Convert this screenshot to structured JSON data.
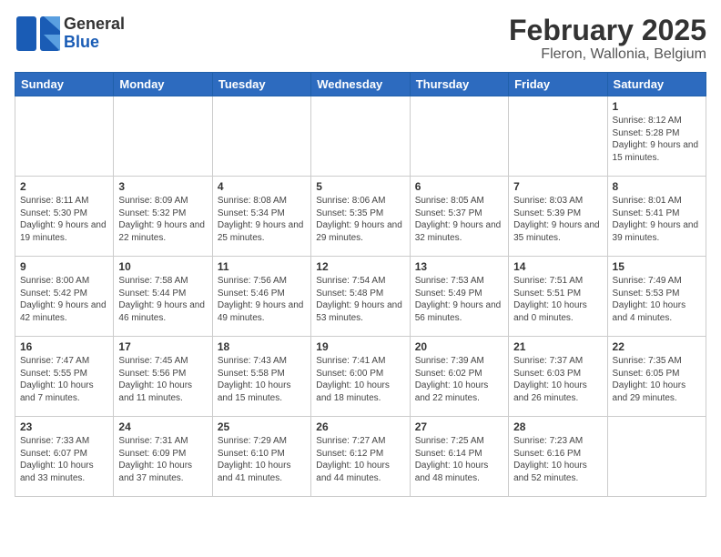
{
  "header": {
    "logo_general": "General",
    "logo_blue": "Blue",
    "title": "February 2025",
    "subtitle": "Fleron, Wallonia, Belgium"
  },
  "calendar": {
    "days_of_week": [
      "Sunday",
      "Monday",
      "Tuesday",
      "Wednesday",
      "Thursday",
      "Friday",
      "Saturday"
    ],
    "weeks": [
      {
        "days": [
          {
            "num": "",
            "detail": ""
          },
          {
            "num": "",
            "detail": ""
          },
          {
            "num": "",
            "detail": ""
          },
          {
            "num": "",
            "detail": ""
          },
          {
            "num": "",
            "detail": ""
          },
          {
            "num": "",
            "detail": ""
          },
          {
            "num": "1",
            "detail": "Sunrise: 8:12 AM\nSunset: 5:28 PM\nDaylight: 9 hours and 15 minutes."
          }
        ]
      },
      {
        "days": [
          {
            "num": "2",
            "detail": "Sunrise: 8:11 AM\nSunset: 5:30 PM\nDaylight: 9 hours and 19 minutes."
          },
          {
            "num": "3",
            "detail": "Sunrise: 8:09 AM\nSunset: 5:32 PM\nDaylight: 9 hours and 22 minutes."
          },
          {
            "num": "4",
            "detail": "Sunrise: 8:08 AM\nSunset: 5:34 PM\nDaylight: 9 hours and 25 minutes."
          },
          {
            "num": "5",
            "detail": "Sunrise: 8:06 AM\nSunset: 5:35 PM\nDaylight: 9 hours and 29 minutes."
          },
          {
            "num": "6",
            "detail": "Sunrise: 8:05 AM\nSunset: 5:37 PM\nDaylight: 9 hours and 32 minutes."
          },
          {
            "num": "7",
            "detail": "Sunrise: 8:03 AM\nSunset: 5:39 PM\nDaylight: 9 hours and 35 minutes."
          },
          {
            "num": "8",
            "detail": "Sunrise: 8:01 AM\nSunset: 5:41 PM\nDaylight: 9 hours and 39 minutes."
          }
        ]
      },
      {
        "days": [
          {
            "num": "9",
            "detail": "Sunrise: 8:00 AM\nSunset: 5:42 PM\nDaylight: 9 hours and 42 minutes."
          },
          {
            "num": "10",
            "detail": "Sunrise: 7:58 AM\nSunset: 5:44 PM\nDaylight: 9 hours and 46 minutes."
          },
          {
            "num": "11",
            "detail": "Sunrise: 7:56 AM\nSunset: 5:46 PM\nDaylight: 9 hours and 49 minutes."
          },
          {
            "num": "12",
            "detail": "Sunrise: 7:54 AM\nSunset: 5:48 PM\nDaylight: 9 hours and 53 minutes."
          },
          {
            "num": "13",
            "detail": "Sunrise: 7:53 AM\nSunset: 5:49 PM\nDaylight: 9 hours and 56 minutes."
          },
          {
            "num": "14",
            "detail": "Sunrise: 7:51 AM\nSunset: 5:51 PM\nDaylight: 10 hours and 0 minutes."
          },
          {
            "num": "15",
            "detail": "Sunrise: 7:49 AM\nSunset: 5:53 PM\nDaylight: 10 hours and 4 minutes."
          }
        ]
      },
      {
        "days": [
          {
            "num": "16",
            "detail": "Sunrise: 7:47 AM\nSunset: 5:55 PM\nDaylight: 10 hours and 7 minutes."
          },
          {
            "num": "17",
            "detail": "Sunrise: 7:45 AM\nSunset: 5:56 PM\nDaylight: 10 hours and 11 minutes."
          },
          {
            "num": "18",
            "detail": "Sunrise: 7:43 AM\nSunset: 5:58 PM\nDaylight: 10 hours and 15 minutes."
          },
          {
            "num": "19",
            "detail": "Sunrise: 7:41 AM\nSunset: 6:00 PM\nDaylight: 10 hours and 18 minutes."
          },
          {
            "num": "20",
            "detail": "Sunrise: 7:39 AM\nSunset: 6:02 PM\nDaylight: 10 hours and 22 minutes."
          },
          {
            "num": "21",
            "detail": "Sunrise: 7:37 AM\nSunset: 6:03 PM\nDaylight: 10 hours and 26 minutes."
          },
          {
            "num": "22",
            "detail": "Sunrise: 7:35 AM\nSunset: 6:05 PM\nDaylight: 10 hours and 29 minutes."
          }
        ]
      },
      {
        "days": [
          {
            "num": "23",
            "detail": "Sunrise: 7:33 AM\nSunset: 6:07 PM\nDaylight: 10 hours and 33 minutes."
          },
          {
            "num": "24",
            "detail": "Sunrise: 7:31 AM\nSunset: 6:09 PM\nDaylight: 10 hours and 37 minutes."
          },
          {
            "num": "25",
            "detail": "Sunrise: 7:29 AM\nSunset: 6:10 PM\nDaylight: 10 hours and 41 minutes."
          },
          {
            "num": "26",
            "detail": "Sunrise: 7:27 AM\nSunset: 6:12 PM\nDaylight: 10 hours and 44 minutes."
          },
          {
            "num": "27",
            "detail": "Sunrise: 7:25 AM\nSunset: 6:14 PM\nDaylight: 10 hours and 48 minutes."
          },
          {
            "num": "28",
            "detail": "Sunrise: 7:23 AM\nSunset: 6:16 PM\nDaylight: 10 hours and 52 minutes."
          },
          {
            "num": "",
            "detail": ""
          }
        ]
      }
    ]
  }
}
